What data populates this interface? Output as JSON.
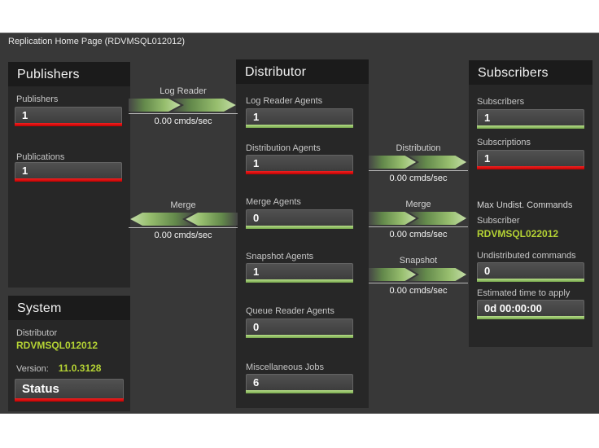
{
  "title_bar": {
    "title": "Replication Home Page (RDVMSQL012012)"
  },
  "publishers_panel": {
    "header": "Publishers",
    "fields": [
      {
        "label": "Publishers",
        "value": "1",
        "status": "red"
      },
      {
        "label": "Publications",
        "value": "1",
        "status": "red"
      }
    ]
  },
  "system_panel": {
    "header": "System",
    "distributor_label": "Distributor",
    "distributor_name": "RDVMSQL012012",
    "version_label": "Version:",
    "version_value": "11.0.3128",
    "status_button_label": "Status",
    "status_button_status": "red"
  },
  "distributor_panel": {
    "header": "Distributor",
    "fields": [
      {
        "label": "Log Reader Agents",
        "value": "1",
        "status": "green"
      },
      {
        "label": "Distribution Agents",
        "value": "1",
        "status": "red"
      },
      {
        "label": "Merge Agents",
        "value": "0",
        "status": "green"
      },
      {
        "label": "Snapshot Agents",
        "value": "1",
        "status": "green"
      },
      {
        "label": "Queue Reader Agents",
        "value": "0",
        "status": "green"
      },
      {
        "label": "Miscellaneous Jobs",
        "value": "6",
        "status": "green"
      }
    ]
  },
  "subscribers_panel": {
    "header": "Subscribers",
    "fields": [
      {
        "label": "Subscribers",
        "value": "1",
        "status": "green"
      },
      {
        "label": "Subscriptions",
        "value": "1",
        "status": "red"
      }
    ],
    "section_label": "Max Undist. Commands",
    "subscriber_label": "Subscriber",
    "subscriber_name": "RDVMSQL022012",
    "undistributed_label": "Undistributed commands",
    "undistributed_value": "0",
    "undistributed_status": "green",
    "eta_label": "Estimated time to apply",
    "eta_value": "0d 00:00:00",
    "eta_status": "green"
  },
  "flows": {
    "log_reader": {
      "label": "Log Reader",
      "rate": "0.00 cmds/sec",
      "direction": "right"
    },
    "merge_pub": {
      "label": "Merge",
      "rate": "0.00 cmds/sec",
      "direction": "left"
    },
    "distribution": {
      "label": "Distribution",
      "rate": "0.00 cmds/sec",
      "direction": "right"
    },
    "merge_sub": {
      "label": "Merge",
      "rate": "0.00 cmds/sec",
      "direction": "right"
    },
    "snapshot": {
      "label": "Snapshot",
      "rate": "0.00 cmds/sec",
      "direction": "right"
    }
  },
  "colors": {
    "status_red": "#d40000",
    "status_green": "#85b958",
    "green_text": "#b5d334",
    "arrow_green": "#a3c97c",
    "panel_bg": "#272727",
    "header_bg": "#1b1b1b",
    "content_bg": "#383838"
  }
}
